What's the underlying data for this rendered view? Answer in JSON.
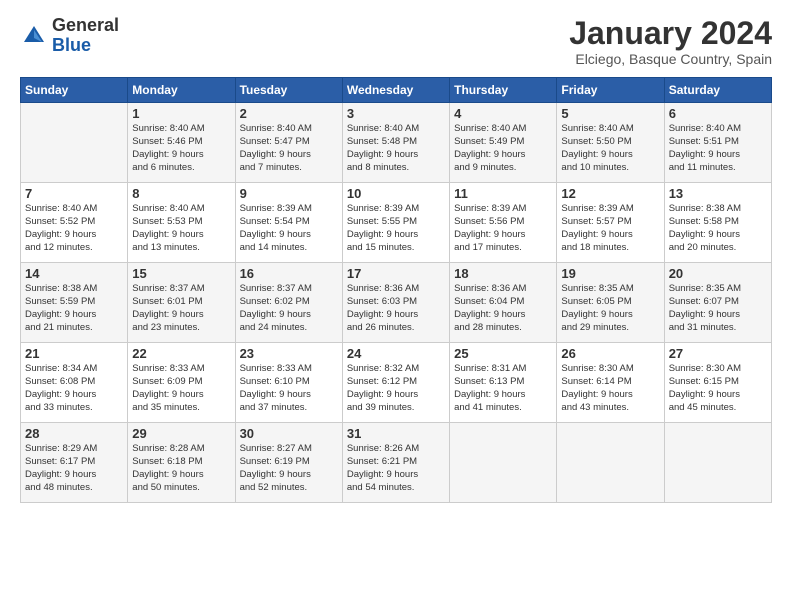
{
  "logo": {
    "general": "General",
    "blue": "Blue"
  },
  "header": {
    "month": "January 2024",
    "location": "Elciego, Basque Country, Spain"
  },
  "weekdays": [
    "Sunday",
    "Monday",
    "Tuesday",
    "Wednesday",
    "Thursday",
    "Friday",
    "Saturday"
  ],
  "weeks": [
    [
      {
        "day": "",
        "info": ""
      },
      {
        "day": "1",
        "info": "Sunrise: 8:40 AM\nSunset: 5:46 PM\nDaylight: 9 hours\nand 6 minutes."
      },
      {
        "day": "2",
        "info": "Sunrise: 8:40 AM\nSunset: 5:47 PM\nDaylight: 9 hours\nand 7 minutes."
      },
      {
        "day": "3",
        "info": "Sunrise: 8:40 AM\nSunset: 5:48 PM\nDaylight: 9 hours\nand 8 minutes."
      },
      {
        "day": "4",
        "info": "Sunrise: 8:40 AM\nSunset: 5:49 PM\nDaylight: 9 hours\nand 9 minutes."
      },
      {
        "day": "5",
        "info": "Sunrise: 8:40 AM\nSunset: 5:50 PM\nDaylight: 9 hours\nand 10 minutes."
      },
      {
        "day": "6",
        "info": "Sunrise: 8:40 AM\nSunset: 5:51 PM\nDaylight: 9 hours\nand 11 minutes."
      }
    ],
    [
      {
        "day": "7",
        "info": "Sunrise: 8:40 AM\nSunset: 5:52 PM\nDaylight: 9 hours\nand 12 minutes."
      },
      {
        "day": "8",
        "info": "Sunrise: 8:40 AM\nSunset: 5:53 PM\nDaylight: 9 hours\nand 13 minutes."
      },
      {
        "day": "9",
        "info": "Sunrise: 8:39 AM\nSunset: 5:54 PM\nDaylight: 9 hours\nand 14 minutes."
      },
      {
        "day": "10",
        "info": "Sunrise: 8:39 AM\nSunset: 5:55 PM\nDaylight: 9 hours\nand 15 minutes."
      },
      {
        "day": "11",
        "info": "Sunrise: 8:39 AM\nSunset: 5:56 PM\nDaylight: 9 hours\nand 17 minutes."
      },
      {
        "day": "12",
        "info": "Sunrise: 8:39 AM\nSunset: 5:57 PM\nDaylight: 9 hours\nand 18 minutes."
      },
      {
        "day": "13",
        "info": "Sunrise: 8:38 AM\nSunset: 5:58 PM\nDaylight: 9 hours\nand 20 minutes."
      }
    ],
    [
      {
        "day": "14",
        "info": "Sunrise: 8:38 AM\nSunset: 5:59 PM\nDaylight: 9 hours\nand 21 minutes."
      },
      {
        "day": "15",
        "info": "Sunrise: 8:37 AM\nSunset: 6:01 PM\nDaylight: 9 hours\nand 23 minutes."
      },
      {
        "day": "16",
        "info": "Sunrise: 8:37 AM\nSunset: 6:02 PM\nDaylight: 9 hours\nand 24 minutes."
      },
      {
        "day": "17",
        "info": "Sunrise: 8:36 AM\nSunset: 6:03 PM\nDaylight: 9 hours\nand 26 minutes."
      },
      {
        "day": "18",
        "info": "Sunrise: 8:36 AM\nSunset: 6:04 PM\nDaylight: 9 hours\nand 28 minutes."
      },
      {
        "day": "19",
        "info": "Sunrise: 8:35 AM\nSunset: 6:05 PM\nDaylight: 9 hours\nand 29 minutes."
      },
      {
        "day": "20",
        "info": "Sunrise: 8:35 AM\nSunset: 6:07 PM\nDaylight: 9 hours\nand 31 minutes."
      }
    ],
    [
      {
        "day": "21",
        "info": "Sunrise: 8:34 AM\nSunset: 6:08 PM\nDaylight: 9 hours\nand 33 minutes."
      },
      {
        "day": "22",
        "info": "Sunrise: 8:33 AM\nSunset: 6:09 PM\nDaylight: 9 hours\nand 35 minutes."
      },
      {
        "day": "23",
        "info": "Sunrise: 8:33 AM\nSunset: 6:10 PM\nDaylight: 9 hours\nand 37 minutes."
      },
      {
        "day": "24",
        "info": "Sunrise: 8:32 AM\nSunset: 6:12 PM\nDaylight: 9 hours\nand 39 minutes."
      },
      {
        "day": "25",
        "info": "Sunrise: 8:31 AM\nSunset: 6:13 PM\nDaylight: 9 hours\nand 41 minutes."
      },
      {
        "day": "26",
        "info": "Sunrise: 8:30 AM\nSunset: 6:14 PM\nDaylight: 9 hours\nand 43 minutes."
      },
      {
        "day": "27",
        "info": "Sunrise: 8:30 AM\nSunset: 6:15 PM\nDaylight: 9 hours\nand 45 minutes."
      }
    ],
    [
      {
        "day": "28",
        "info": "Sunrise: 8:29 AM\nSunset: 6:17 PM\nDaylight: 9 hours\nand 48 minutes."
      },
      {
        "day": "29",
        "info": "Sunrise: 8:28 AM\nSunset: 6:18 PM\nDaylight: 9 hours\nand 50 minutes."
      },
      {
        "day": "30",
        "info": "Sunrise: 8:27 AM\nSunset: 6:19 PM\nDaylight: 9 hours\nand 52 minutes."
      },
      {
        "day": "31",
        "info": "Sunrise: 8:26 AM\nSunset: 6:21 PM\nDaylight: 9 hours\nand 54 minutes."
      },
      {
        "day": "",
        "info": ""
      },
      {
        "day": "",
        "info": ""
      },
      {
        "day": "",
        "info": ""
      }
    ]
  ]
}
